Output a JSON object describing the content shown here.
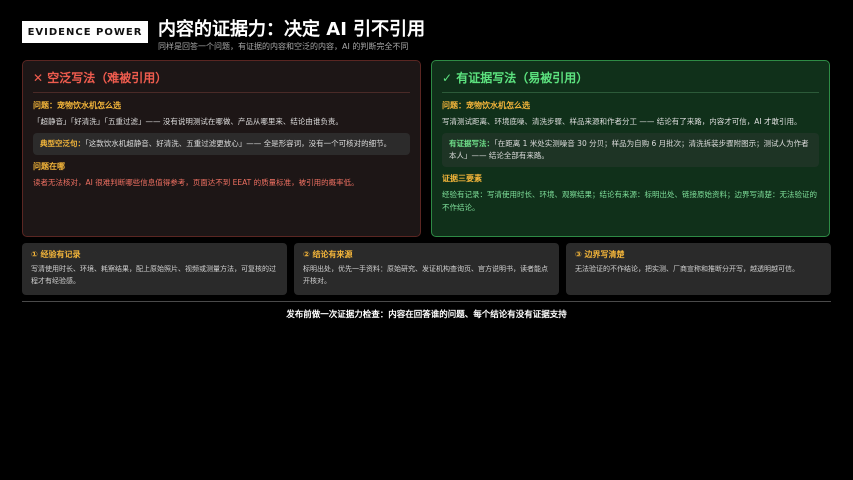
{
  "header": {
    "badge": "EVIDENCE POWER",
    "title": "内容的证据力：决定 AI 引不引用",
    "subtitle": "同样是回答一个问题，有证据的内容和空泛的内容，AI 的判断完全不同"
  },
  "bad": {
    "icon": "✕",
    "title": "空泛写法（难被引用）",
    "question_label": "问题：宠物饮水机怎么选",
    "description": "「超静音」「好清洗」「五重过滤」—— 没有说明测试在哪做、产品从哪里来、结论由谁负责。",
    "example_label": "典型空泛句：",
    "example_text": "「这款饮水机超静音、好清洗、五重过滤更放心」—— 全是形容词，没有一个可核对的细节。",
    "issue_label": "问题在哪",
    "issue_text": "读者无法核对，AI 很难判断哪些信息值得参考，页面达不到 EEAT 的质量标准，被引用的概率低。"
  },
  "good": {
    "icon": "✓",
    "title": "有证据写法（易被引用）",
    "question_label": "问题：宠物饮水机怎么选",
    "description": "写清测试距离、环境底噪、清洗步骤、样品来源和作者分工 —— 结论有了来路，内容才可信，AI 才敢引用。",
    "example_label": "有证据写法：",
    "example_text": "「在距离 1 米处实测噪音 30 分贝；样品为自购 6 月批次；清洗拆装步骤附图示；测试人为作者本人」—— 结论全部有来路。",
    "elements_label": "证据三要素",
    "elements_text": "经验有记录：写清使用时长、环境、观察结果；结论有来源：标明出处、链接原始资料；边界写清楚：无法验证的不作结论。"
  },
  "cards": [
    {
      "title": "① 经验有记录",
      "text": "写清使用时长、环境、耗察结果，配上原始照片、视频或测量方法，可复核的过程才有经验感。"
    },
    {
      "title": "② 结论有来源",
      "text": "标明出处，优先一手资料：原始研究、发证机构查询页、官方说明书，读者能点开核对。"
    },
    {
      "title": "③ 边界写清楚",
      "text": "无法验证的不作结论，把实测、厂商宣称和推断分开写，越透明越可信。"
    }
  ],
  "footer": "发布前做一次证据力检查：内容在回答谁的问题、每个结论有没有证据支持",
  "colors": {
    "bad_accent": "#ef5c4e",
    "good_accent": "#5ce27f",
    "label_accent": "#f3b53a"
  }
}
